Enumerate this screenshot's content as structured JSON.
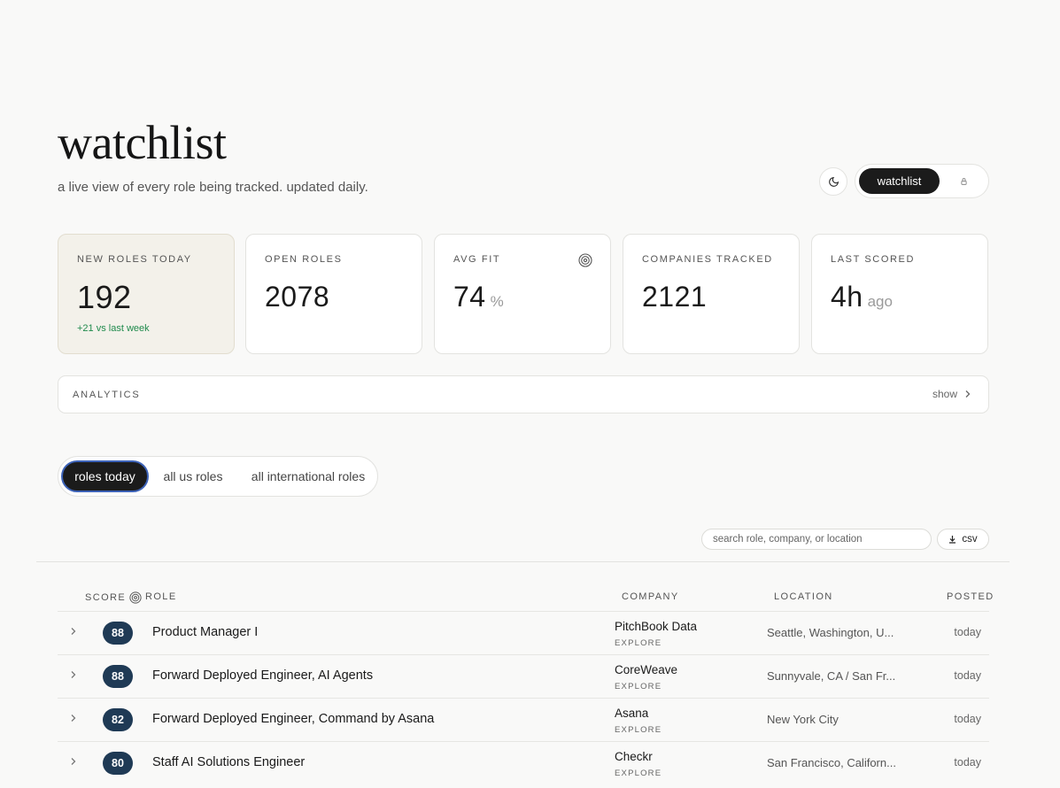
{
  "header": {
    "title": "watchlist",
    "subtitle": "a live view of every role being tracked. updated daily.",
    "view_active": "watchlist"
  },
  "stats": [
    {
      "label": "NEW ROLES TODAY",
      "value": "192",
      "delta": "+21 vs last week"
    },
    {
      "label": "OPEN ROLES",
      "value": "2078"
    },
    {
      "label": "AVG FIT",
      "value": "74",
      "unit": "%"
    },
    {
      "label": "COMPANIES TRACKED",
      "value": "2121"
    },
    {
      "label": "LAST SCORED",
      "value": "4h",
      "unit": "ago"
    }
  ],
  "analytics": {
    "label": "ANALYTICS",
    "toggle": "show"
  },
  "tabs": [
    "roles today",
    "all us roles",
    "all international roles"
  ],
  "toolbar": {
    "search_placeholder": "search role, company, or location",
    "csv_label": "csv"
  },
  "table": {
    "headers": {
      "score": "SCORE",
      "role": "ROLE",
      "company": "COMPANY",
      "location": "LOCATION",
      "posted": "POSTED"
    },
    "rows": [
      {
        "score": "88",
        "role": "Product Manager I",
        "company": "PitchBook Data",
        "explore": "EXPLORE",
        "location": "Seattle, Washington, U...",
        "posted": "today"
      },
      {
        "score": "88",
        "role": "Forward Deployed Engineer, AI Agents",
        "company": "CoreWeave",
        "explore": "EXPLORE",
        "location": "Sunnyvale, CA / San Fr...",
        "posted": "today"
      },
      {
        "score": "82",
        "role": "Forward Deployed Engineer, Command by Asana",
        "company": "Asana",
        "explore": "EXPLORE",
        "location": "New York City",
        "posted": "today"
      },
      {
        "score": "80",
        "role": "Staff AI Solutions Engineer",
        "company": "Checkr",
        "explore": "EXPLORE",
        "location": "San Francisco, Californ...",
        "posted": "today"
      }
    ]
  },
  "colors": {
    "accent_dark": "#1b1b1b",
    "badge": "#1f3a55",
    "delta_green": "#1f8a4c",
    "highlight_card": "#f3f1ea"
  },
  "icons": {
    "theme": "moon-icon",
    "lock": "lock-icon",
    "target": "target-icon",
    "chevron": "chevron-right-icon",
    "download": "download-icon"
  }
}
